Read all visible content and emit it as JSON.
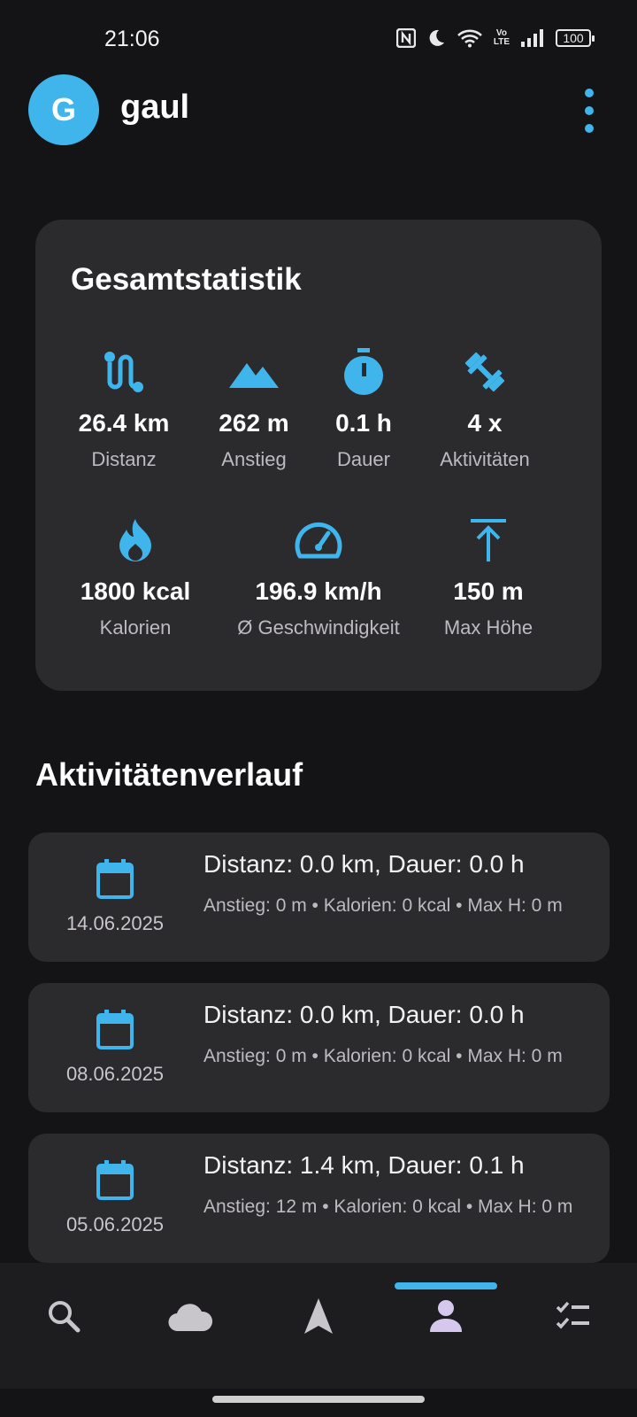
{
  "status_bar": {
    "time": "21:06",
    "battery": "100",
    "icons": [
      "nfc-icon",
      "moon-icon",
      "wifi-icon",
      "volte-icon",
      "signal-icon",
      "battery-icon"
    ]
  },
  "header": {
    "avatar_initial": "G",
    "username": "gaul",
    "menu_icon": "more-vertical-icon"
  },
  "colors": {
    "accent": "#3fb5ec",
    "background": "#141316",
    "card": "#2b2a2d",
    "nav_active": "#d6c8ec"
  },
  "stats": {
    "title": "Gesamtstatistik",
    "items": [
      {
        "icon": "route-icon",
        "value": "26.4 km",
        "label": "Distanz"
      },
      {
        "icon": "mountain-icon",
        "value": "262 m",
        "label": "Anstieg"
      },
      {
        "icon": "timer-icon",
        "value": "0.1 h",
        "label": "Dauer"
      },
      {
        "icon": "dumbbell-icon",
        "value": "4 x",
        "label": "Aktivitäten"
      },
      {
        "icon": "flame-icon",
        "value": "1800 kcal",
        "label": "Kalorien"
      },
      {
        "icon": "speedometer-icon",
        "value": "196.9 km/h",
        "label": "Ø Geschwindigkeit"
      },
      {
        "icon": "max-height-icon",
        "value": "150 m",
        "label": "Max Höhe"
      }
    ]
  },
  "history": {
    "title": "Aktivitätenverlauf",
    "items": [
      {
        "date": "14.06.2025",
        "main": "Distanz: 0.0 km, Dauer: 0.0 h",
        "sub": "Anstieg: 0 m • Kalorien: 0 kcal • Max H: 0 m"
      },
      {
        "date": "08.06.2025",
        "main": "Distanz: 0.0 km, Dauer: 0.0 h",
        "sub": "Anstieg: 0 m • Kalorien: 0 kcal • Max H: 0 m"
      },
      {
        "date": "05.06.2025",
        "main": "Distanz: 1.4 km, Dauer: 0.1 h",
        "sub": "Anstieg: 12 m • Kalorien: 0 kcal • Max H: 0 m"
      }
    ]
  },
  "bottom_nav": {
    "items": [
      "search-icon",
      "cloud-icon",
      "navigation-icon",
      "person-icon",
      "checklist-icon"
    ],
    "active_index": 3
  }
}
